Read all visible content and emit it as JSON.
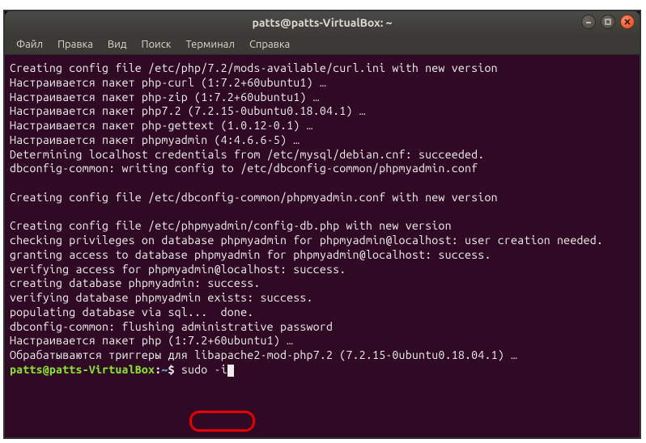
{
  "window": {
    "title": "patts@patts-VirtualBox: ~"
  },
  "menu": {
    "items": [
      "Файл",
      "Правка",
      "Вид",
      "Поиск",
      "Терминал",
      "Справка"
    ]
  },
  "terminal": {
    "lines": [
      "Creating config file /etc/php/7.2/mods-available/curl.ini with new version",
      "Настраивается пакет php-curl (1:7.2+60ubuntu1) …",
      "Настраивается пакет php-zip (1:7.2+60ubuntu1) …",
      "Настраивается пакет php7.2 (7.2.15-0ubuntu0.18.04.1) …",
      "Настраивается пакет php-gettext (1.0.12-0.1) …",
      "Настраивается пакет phpmyadmin (4:4.6.6-5) …",
      "Determining localhost credentials from /etc/mysql/debian.cnf: succeeded.",
      "dbconfig-common: writing config to /etc/dbconfig-common/phpmyadmin.conf",
      "",
      "Creating config file /etc/dbconfig-common/phpmyadmin.conf with new version",
      "",
      "Creating config file /etc/phpmyadmin/config-db.php with new version",
      "checking privileges on database phpmyadmin for phpmyadmin@localhost: user creation needed.",
      "granting access to database phpmyadmin for phpmyadmin@localhost: success.",
      "verifying access for phpmyadmin@localhost: success.",
      "creating database phpmyadmin: success.",
      "verifying database phpmyadmin exists: success.",
      "populating database via sql...  done.",
      "dbconfig-common: flushing administrative password",
      "Настраивается пакет php (1:7.2+60ubuntu1) …",
      "Обрабатываются триггеры для libapache2-mod-php7.2 (7.2.15-0ubuntu0.18.04.1) …"
    ],
    "prompt": {
      "user_host": "patts@patts-VirtualBox",
      "sep": ":",
      "path": "~",
      "dollar": "$",
      "command": "sudo -i"
    }
  }
}
